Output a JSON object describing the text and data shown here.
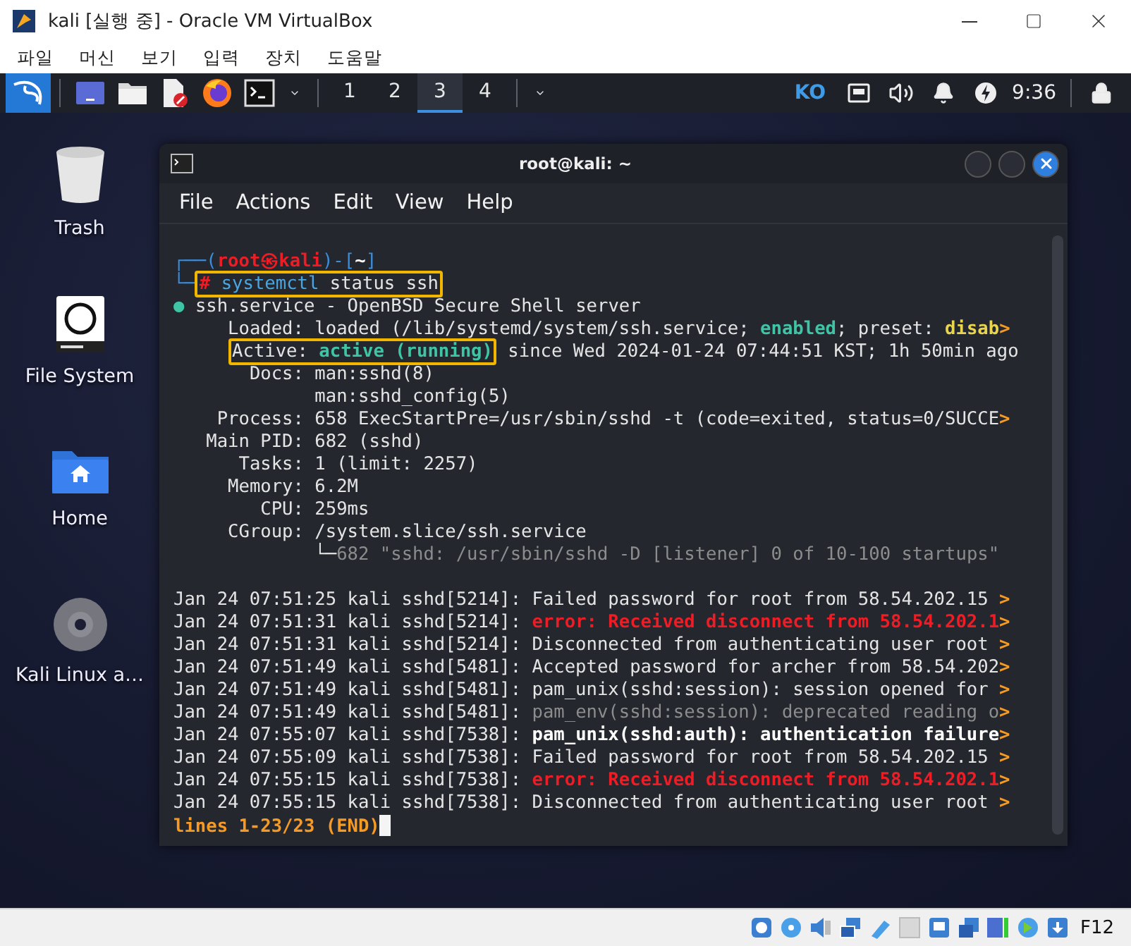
{
  "window": {
    "title": "kali [실행 중] - Oracle VM VirtualBox"
  },
  "menu": [
    "파일",
    "머신",
    "보기",
    "입력",
    "장치",
    "도움말"
  ],
  "panel": {
    "workspaces": [
      {
        "label": "1",
        "selected": false
      },
      {
        "label": "2",
        "selected": false
      },
      {
        "label": "3",
        "selected": true
      },
      {
        "label": "4",
        "selected": false
      }
    ],
    "keyboard_layout": "KO",
    "clock": "9:36"
  },
  "desktop_icons": [
    {
      "label": "Trash",
      "kind": "trash"
    },
    {
      "label": "File System",
      "kind": "drive"
    },
    {
      "label": "Home",
      "kind": "home"
    },
    {
      "label": "Kali Linux a…",
      "kind": "disc"
    }
  ],
  "terminal": {
    "title": "root@kali: ~",
    "menu": [
      "File",
      "Actions",
      "Edit",
      "View",
      "Help"
    ],
    "status_lines": [
      [
        {
          "text": "┌──(",
          "kind": "frame"
        },
        {
          "text": "root㉿kali",
          "kind": "host"
        },
        {
          "text": ")-[",
          "kind": "frame"
        },
        {
          "text": "~",
          "kind": "dir"
        },
        {
          "text": "]",
          "kind": "frame"
        }
      ],
      [
        {
          "text": "└─",
          "kind": "frame"
        },
        {
          "kind": "highlight",
          "parts": [
            {
              "text": "#",
              "kind": "sign"
            },
            {
              "text": " systemctl",
              "kind": "command"
            },
            {
              "text": " status ssh",
              "kind": "text"
            }
          ]
        }
      ],
      [
        {
          "text": "●",
          "kind": "ok"
        },
        {
          "text": " ssh.service - OpenBSD Secure Shell server",
          "kind": "text"
        }
      ],
      [
        {
          "text": "     Loaded: loaded (/lib/systemd/system/ssh.service; ",
          "kind": "text"
        },
        {
          "text": "enabled",
          "kind": "ok"
        },
        {
          "text": "; preset: ",
          "kind": "text"
        },
        {
          "text": "disab",
          "kind": "warn"
        },
        {
          "text": ">",
          "kind": "more"
        }
      ],
      [
        {
          "kind": "highlight",
          "parts": [
            {
              "text": "     Active: ",
              "kind": "text"
            },
            {
              "text": "active (running)",
              "kind": "ok"
            }
          ]
        },
        {
          "text": " since Wed 2024-01-24 07:44:51 KST; 1h 50min ago",
          "kind": "text"
        }
      ],
      [
        {
          "text": "       Docs: man:sshd(8)",
          "kind": "text"
        }
      ],
      [
        {
          "text": "             man:sshd_config(5)",
          "kind": "text"
        }
      ],
      [
        {
          "text": "    Process: 658 ExecStartPre=/usr/sbin/sshd -t (code=exited, status=0/SUCCE",
          "kind": "text"
        },
        {
          "text": ">",
          "kind": "more"
        }
      ],
      [
        {
          "text": "   Main PID: 682 (sshd)",
          "kind": "text"
        }
      ],
      [
        {
          "text": "      Tasks: 1 (limit: 2257)",
          "kind": "text"
        }
      ],
      [
        {
          "text": "     Memory: 6.2M",
          "kind": "text"
        }
      ],
      [
        {
          "text": "        CPU: 259ms",
          "kind": "text"
        }
      ],
      [
        {
          "text": "     CGroup: /system.slice/ssh.service",
          "kind": "text"
        }
      ],
      [
        {
          "text": "             └─",
          "kind": "text"
        },
        {
          "text": "682 \"sshd: /usr/sbin/sshd -D [listener] 0 of 10-100 startups\"",
          "kind": "faded"
        }
      ]
    ],
    "log_lines": [
      [
        {
          "text": "Jan 24 07:51:25 kali sshd[5214]: Failed password for root from 58.54.202.15 ",
          "kind": "text"
        },
        {
          "text": ">",
          "kind": "more"
        }
      ],
      [
        {
          "text": "Jan 24 07:51:31 kali sshd[5214]: ",
          "kind": "text"
        },
        {
          "text": "error: Received disconnect from 58.54.202.1",
          "kind": "error"
        },
        {
          "text": ">",
          "kind": "more"
        }
      ],
      [
        {
          "text": "Jan 24 07:51:31 kali sshd[5214]: Disconnected from authenticating user root ",
          "kind": "text"
        },
        {
          "text": ">",
          "kind": "more"
        }
      ],
      [
        {
          "text": "Jan 24 07:51:49 kali sshd[5481]: Accepted password for archer from 58.54.202",
          "kind": "text"
        },
        {
          "text": ">",
          "kind": "more"
        }
      ],
      [
        {
          "text": "Jan 24 07:51:49 kali sshd[5481]: pam_unix(sshd:session): session opened for ",
          "kind": "text"
        },
        {
          "text": ">",
          "kind": "more"
        }
      ],
      [
        {
          "text": "Jan 24 07:51:49 kali sshd[5481]: ",
          "kind": "text"
        },
        {
          "text": "pam_env(sshd:session): deprecated reading o",
          "kind": "faded"
        },
        {
          "text": ">",
          "kind": "more"
        }
      ],
      [
        {
          "text": "Jan 24 07:55:07 kali sshd[7538]: ",
          "kind": "text"
        },
        {
          "text": "pam_unix(sshd:auth): authentication failure",
          "kind": "strong"
        },
        {
          "text": ">",
          "kind": "more"
        }
      ],
      [
        {
          "text": "Jan 24 07:55:09 kali sshd[7538]: Failed password for root from 58.54.202.15 ",
          "kind": "text"
        },
        {
          "text": ">",
          "kind": "more"
        }
      ],
      [
        {
          "text": "Jan 24 07:55:15 kali sshd[7538]: ",
          "kind": "text"
        },
        {
          "text": "error: Received disconnect from 58.54.202.1",
          "kind": "error"
        },
        {
          "text": ">",
          "kind": "more"
        }
      ],
      [
        {
          "text": "Jan 24 07:55:15 kali sshd[7538]: Disconnected from authenticating user root ",
          "kind": "text"
        },
        {
          "text": ">",
          "kind": "more"
        }
      ]
    ],
    "pager": {
      "text": "lines 1-23/23 (END)",
      "cursor": true
    }
  },
  "status_bar": {
    "host_key": "F12"
  }
}
